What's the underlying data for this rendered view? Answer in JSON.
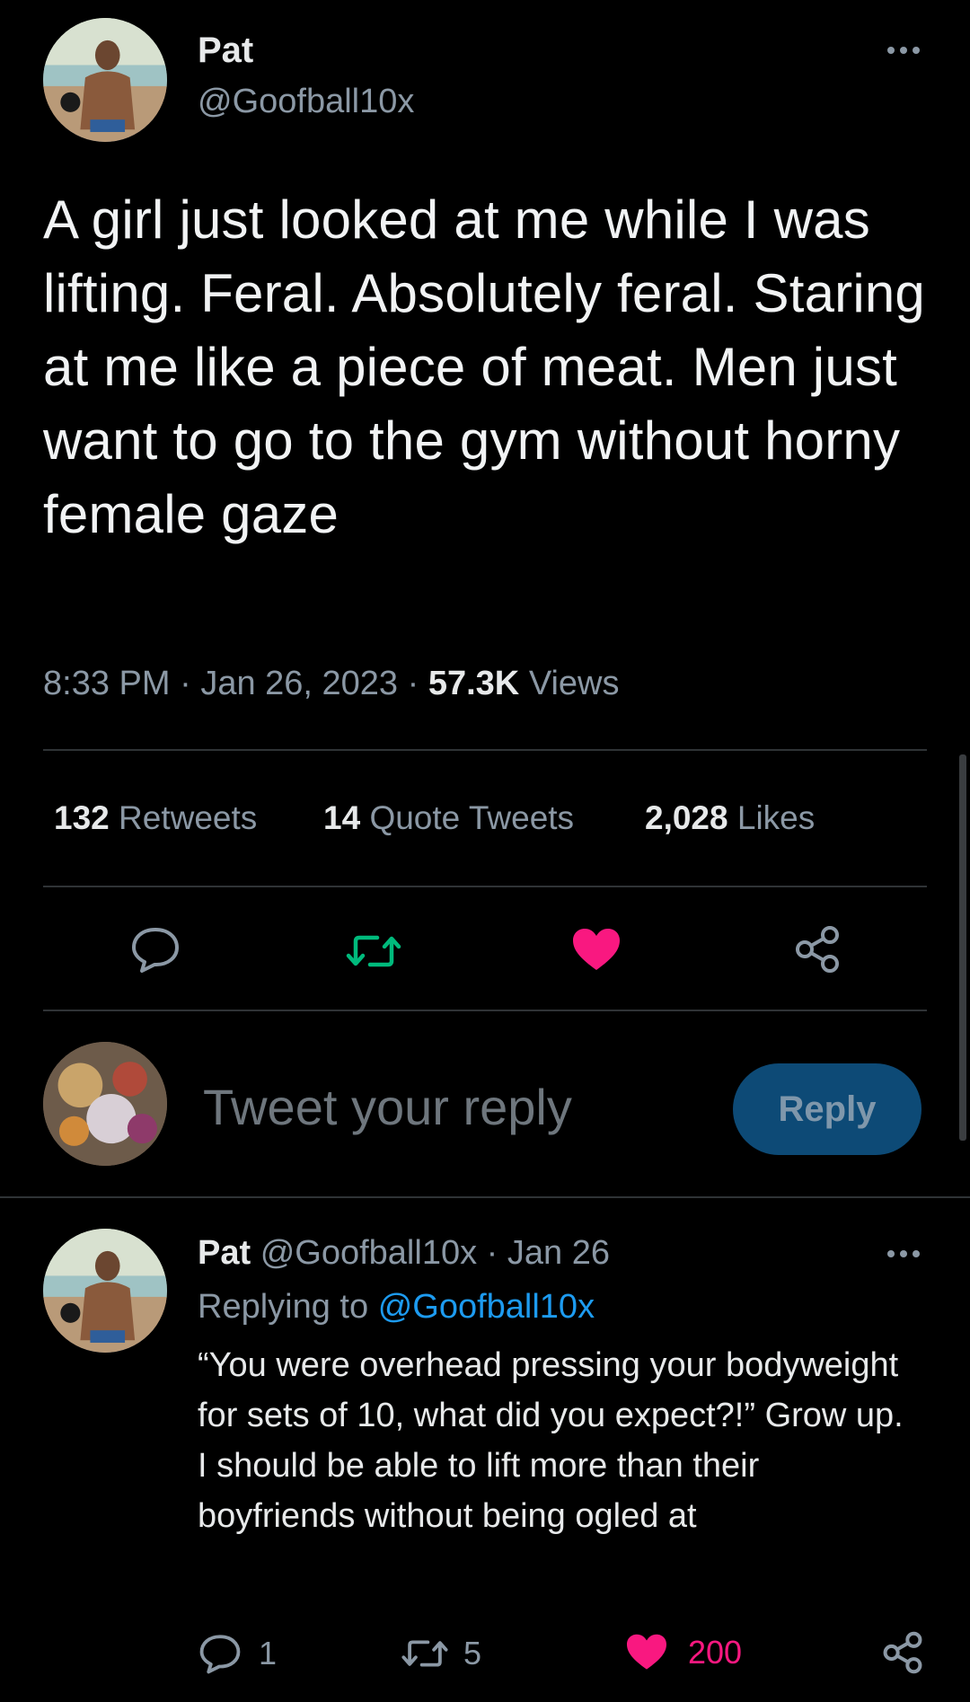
{
  "main_tweet": {
    "author_name": "Pat",
    "author_handle": "@Goofball10x",
    "text": "A girl just looked at me while I was lifting. Feral. Absolutely feral. Staring at me like a piece of meat. Men just want to go to the gym without horny female gaze",
    "time": "8:33 PM",
    "date": "Jan 26, 2023",
    "views_count": "57.3K",
    "views_label": "Views",
    "separator": "·"
  },
  "stats": {
    "retweets_count": "132",
    "retweets_label": "Retweets",
    "quotes_count": "14",
    "quotes_label": "Quote Tweets",
    "likes_count": "2,028",
    "likes_label": "Likes"
  },
  "composer": {
    "placeholder": "Tweet your reply",
    "reply_button": "Reply"
  },
  "reply_tweet": {
    "author_name": "Pat",
    "author_handle": "@Goofball10x",
    "date": "· Jan 26",
    "replying_prefix": "Replying to",
    "replying_handle": "@Goofball10x",
    "text": "“You were overhead pressing your bodyweight for sets of 10, what did you expect?!” Grow up. I should be able to lift more than their boyfriends without being ogled at",
    "reply_count": "1",
    "retweet_count": "5",
    "like_count": "200"
  },
  "icons": {
    "more": "more-horizontal-icon",
    "reply": "comment-bubble-icon",
    "retweet": "retweet-icon",
    "like": "heart-icon",
    "share": "share-icon"
  },
  "colors": {
    "background": "#000000",
    "text": "#e7e9ea",
    "secondary": "#8b98a5",
    "link": "#1d9bf0",
    "retweet_green": "#00ba7c",
    "like_pink": "#f91880",
    "reply_button_bg": "#0d4a76"
  }
}
